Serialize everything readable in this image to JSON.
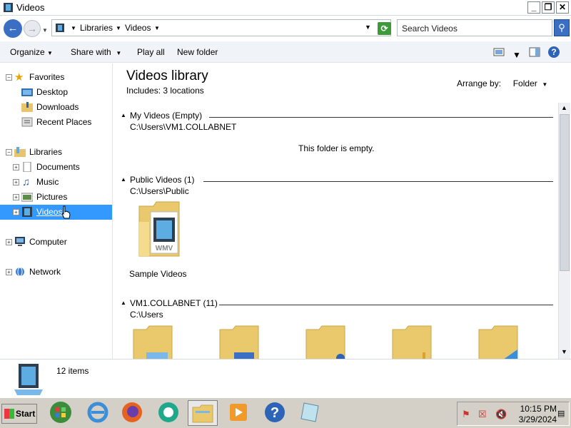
{
  "window": {
    "title": "Videos",
    "minimize": "_",
    "maximize": "❐",
    "close": "✕"
  },
  "address": {
    "crumbs": [
      "Libraries",
      "Videos"
    ],
    "search_placeholder": "Search Videos"
  },
  "toolbar": {
    "organize": "Organize",
    "share_with": "Share with",
    "play_all": "Play all",
    "new_folder": "New folder"
  },
  "nav": {
    "favorites": "Favorites",
    "favorites_items": [
      "Desktop",
      "Downloads",
      "Recent Places"
    ],
    "libraries": "Libraries",
    "libraries_items": [
      "Documents",
      "Music",
      "Pictures",
      "Videos"
    ],
    "computer": "Computer",
    "network": "Network"
  },
  "library": {
    "title": "Videos library",
    "includes_label": "Includes:",
    "includes_link": "3 locations",
    "arrange_label": "Arrange by:",
    "arrange_value": "Folder"
  },
  "groups": [
    {
      "name": "My Videos (Empty)",
      "path": "C:\\Users\\VM1.COLLABNET",
      "empty_text": "This folder is empty."
    },
    {
      "name": "Public Videos (1)",
      "path": "C:\\Users\\Public",
      "items": [
        "Sample Videos"
      ]
    },
    {
      "name": "VM1.COLLABNET (11)",
      "path": "C:\\Users"
    }
  ],
  "details": {
    "count": "12 items"
  },
  "taskbar": {
    "start": "Start",
    "time": "10:15 PM",
    "date": "3/29/2024"
  }
}
